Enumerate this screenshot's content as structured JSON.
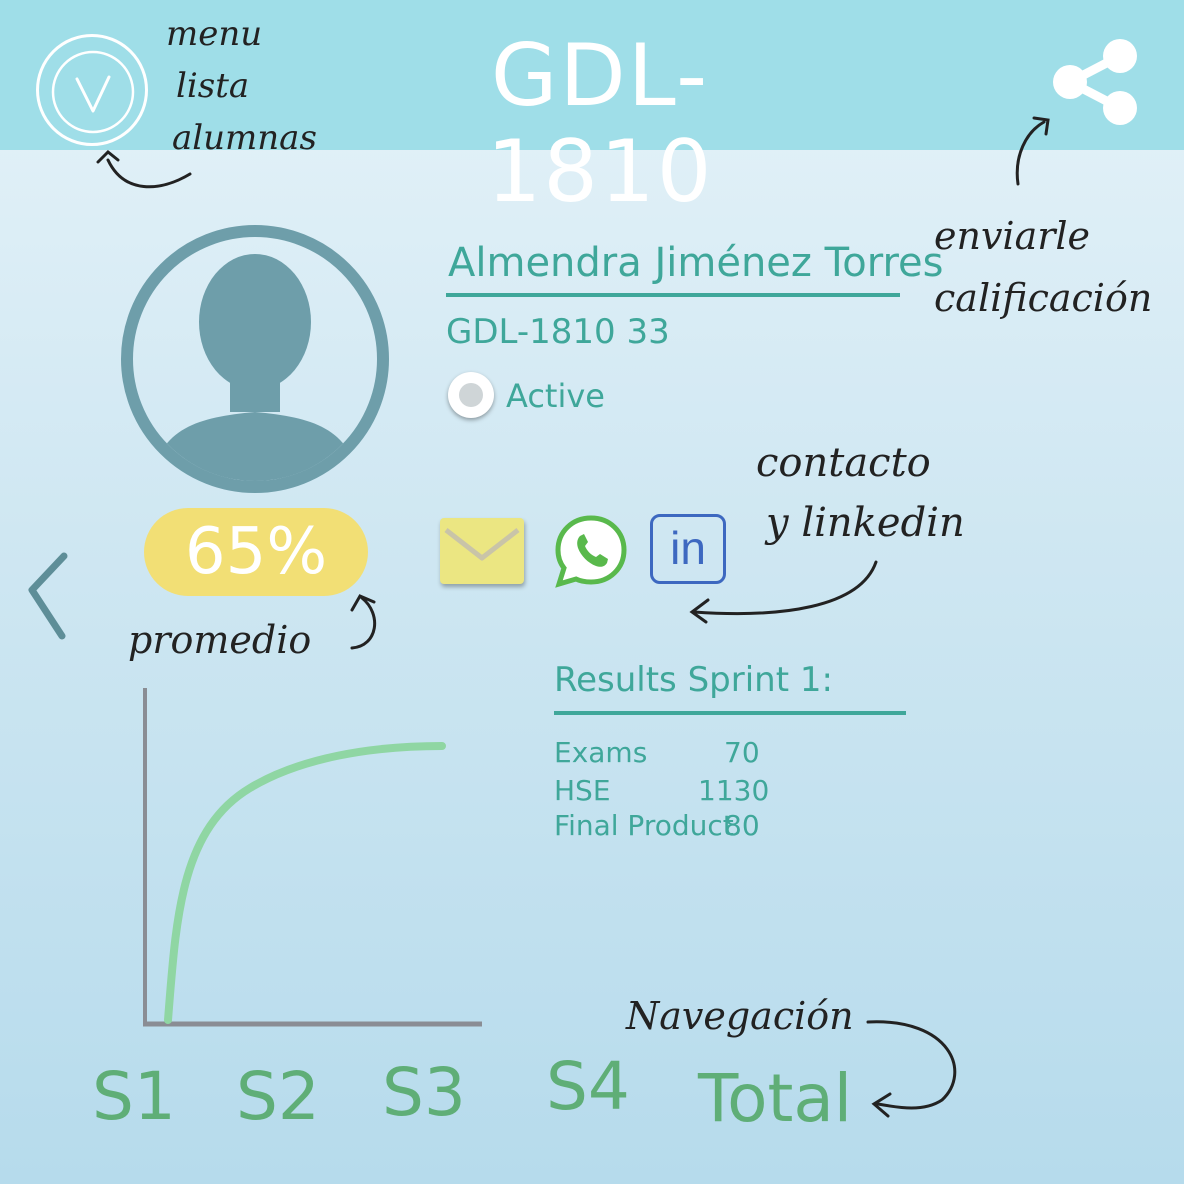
{
  "header": {
    "title": "GDL- 1810",
    "menu_icon": "menu-circle-icon",
    "share_icon": "share-icon"
  },
  "annotations": {
    "menu_line1": "menu",
    "menu_line2": "lista",
    "menu_line3": "alumnas",
    "share_line1": "enviarle",
    "share_line2": "calificación",
    "contact_line1": "contacto",
    "contact_line2": "y linkedin",
    "average": "promedio",
    "navigation": "Navegación"
  },
  "student": {
    "name": "Almendra Jiménez Torres",
    "id": "GDL-1810 33",
    "status": "Active",
    "average_percent": "65%"
  },
  "contact": {
    "email_icon": "mail-icon",
    "whatsapp_icon": "whatsapp-icon",
    "linkedin_label": "in"
  },
  "results": {
    "title": "Results Sprint 1:",
    "rows": [
      {
        "label": "Exams",
        "value": "70"
      },
      {
        "label": "HSE",
        "value": "1130"
      },
      {
        "label": "Final Product",
        "value": "80"
      }
    ]
  },
  "tabs": [
    "S1",
    "S2",
    "S3",
    "S4",
    "Total"
  ],
  "colors": {
    "header": "#9fdee8",
    "accent": "#3fa79a",
    "badge": "#f2df75",
    "curve": "#8fd6a3",
    "tabs": "#5fae77"
  }
}
